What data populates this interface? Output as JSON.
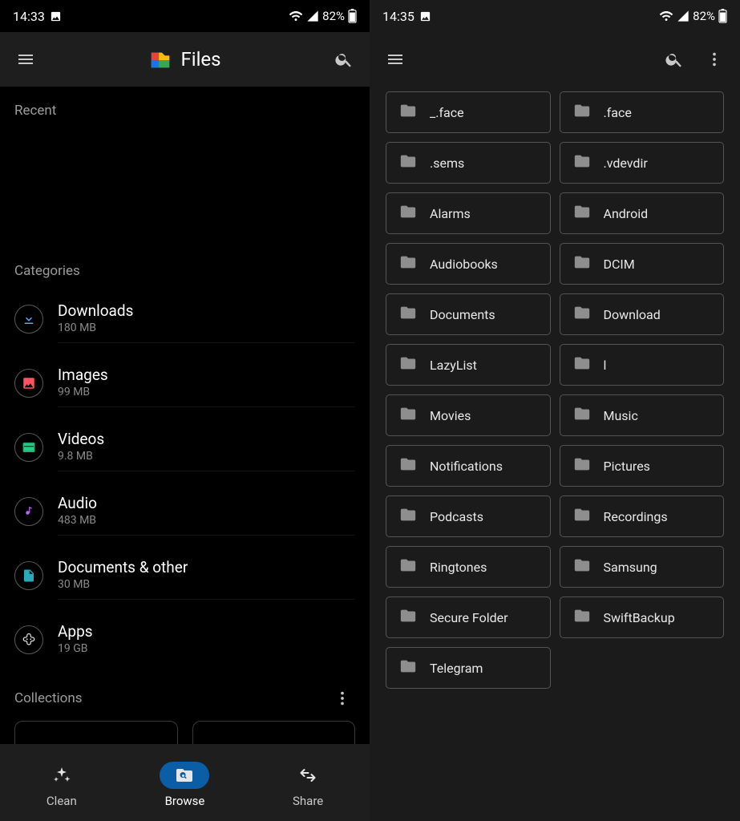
{
  "left": {
    "status": {
      "time": "14:33",
      "battery": "82%"
    },
    "app": {
      "title": "Files"
    },
    "recent_label": "Recent",
    "categories_label": "Categories",
    "categories": [
      {
        "name": "Downloads",
        "size": "180 MB",
        "icon": "download",
        "color": "#5fa5ff"
      },
      {
        "name": "Images",
        "size": "99 MB",
        "icon": "image",
        "color": "#ff5260"
      },
      {
        "name": "Videos",
        "size": "9.8 MB",
        "icon": "video",
        "color": "#22d085"
      },
      {
        "name": "Audio",
        "size": "483 MB",
        "icon": "audio",
        "color": "#c060ff"
      },
      {
        "name": "Documents & other",
        "size": "30 MB",
        "icon": "document",
        "color": "#2aa9b8"
      },
      {
        "name": "Apps",
        "size": "19 GB",
        "icon": "apps",
        "color": "#e8e8e8"
      }
    ],
    "collections_label": "Collections",
    "nav": [
      {
        "label": "Clean",
        "icon": "sparkle",
        "active": false
      },
      {
        "label": "Browse",
        "icon": "browse",
        "active": true
      },
      {
        "label": "Share",
        "icon": "share",
        "active": false
      }
    ]
  },
  "right": {
    "status": {
      "time": "14:35",
      "battery": "82%"
    },
    "folders": [
      "_.face",
      ".face",
      ".sems",
      ".vdevdir",
      "Alarms",
      "Android",
      "Audiobooks",
      "DCIM",
      "Documents",
      "Download",
      "LazyList",
      "l",
      "Movies",
      "Music",
      "Notifications",
      "Pictures",
      "Podcasts",
      "Recordings",
      "Ringtones",
      "Samsung",
      "Secure Folder",
      "SwiftBackup",
      "Telegram"
    ]
  }
}
